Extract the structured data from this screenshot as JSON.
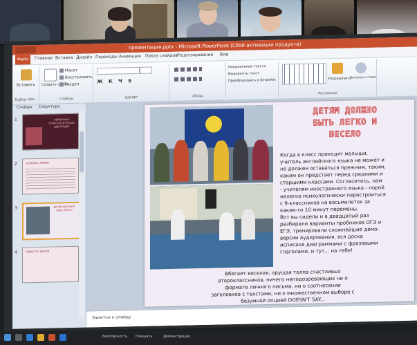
{
  "window": {
    "title": "презентация.pptx - Microsoft PowerPoint (Сбой активации продукта)"
  },
  "ribbon": {
    "file_tab": "Файл",
    "tabs": [
      "Главная",
      "Вставка",
      "Дизайн",
      "Переходы",
      "Анимация",
      "Показ слайдов",
      "Рецензирование",
      "Вид"
    ],
    "groups": {
      "clipboard": "Буфер обм...",
      "slides": "Слайды",
      "font": "Шрифт",
      "paragraph": "Абзац",
      "drawing": "Рисование"
    },
    "buttons": {
      "paste": "Вставить",
      "create_slide": "Создать слайд",
      "layout": "Макет",
      "reset": "Восстановить",
      "section": "Раздел",
      "text_direction": "Направление текста",
      "align_text": "Выровнять текст",
      "smartart": "Преобразовать в SmartArt",
      "arrange": "Упорядочить",
      "quick_styles": "Экспресс-стили"
    }
  },
  "left_pane": {
    "tabs": [
      "Слайды",
      "Структура"
    ],
    "slides": [
      {
        "number": "1",
        "title": "ПЕРВИЧНАЯ ПСИХОЛОГИЧЕСКАЯ АДАПТАЦИЯ"
      },
      {
        "number": "2",
        "title": "НЕЗАБЫТЬ ПРИМИ"
      },
      {
        "number": "3",
        "title": "ДЕТЯМ ДОЛЖНО БЫТЬ ЛЕГКО"
      },
      {
        "number": "4",
        "title": "ГИБКОСТЬ МЫСЛИ"
      }
    ]
  },
  "slide": {
    "title_lines": [
      "ДЕТЯМ ДОЛЖНО",
      "БЫТЬ ЛЕГКО И",
      "ВЕСЕЛО"
    ],
    "right_text": [
      "Когда в класс приходят малыши,",
      "учитель английского языка не может и",
      "не должен оставаться прежним, таким,",
      "каким он предстает перед средними и",
      "старшими классами. Согласитесь, нам",
      "- учителям иностранного языка - порой",
      "нелегко психологически перестроиться",
      "с 9-классников на восьмилеток за",
      "какие-то 10 минут перемены.",
      "Вот вы сидели и в двадцатый раз",
      "разбирали варианты пробников ОГЭ и",
      "ЕГЭ, тренировали сложнейшие демо-",
      "версии аудирования, вся доска",
      "исписана диаграммами с фразовыми",
      "глаголами, и тут... на тебе!"
    ],
    "bottom_text": [
      "Вбегает веселая, орущая толпа счастливых",
      "второклассников, ничего неподозревающих ни о",
      "формате личного письма, ни о соотнесении",
      "заголовков с текстами, ни о множественном выборе с",
      "безумной опцией DOESN'T SAY..."
    ]
  },
  "notes": {
    "placeholder": "Заметки к слайду"
  },
  "taskbar": {
    "labels": [
      "Безопасность",
      "Показать",
      "Демонстрация"
    ]
  }
}
